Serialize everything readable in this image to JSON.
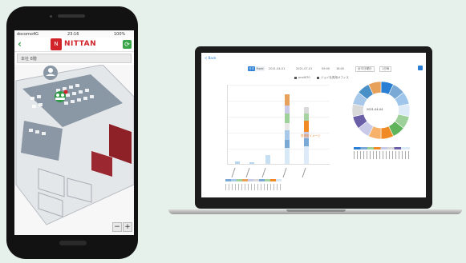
{
  "colors": {
    "brand": "#d0232a",
    "accent": "#2e9a45",
    "primary": "#2a7fd4",
    "highlight": "#f08a24"
  },
  "phone": {
    "status": {
      "carrier": "docomo",
      "network": "4G",
      "time": "23:16",
      "battery": "100%"
    },
    "brand": "NITTAN",
    "floor": "本社 8階",
    "icons": {
      "back": "back-arrow-icon",
      "refresh": "refresh-icon",
      "zoom_out": "minus-icon",
      "zoom_in": "plus-icon",
      "user": "user-icon",
      "group": "group-icon"
    },
    "zoom_out_label": "−",
    "zoom_in_label": "+"
  },
  "laptop": {
    "back": "< Back",
    "toolbar": {
      "toggle_a": "日次",
      "toggle_b": "Fixed",
      "date_from": "2021-04-01",
      "date_to": "2021-07-01",
      "time_from": "09:00",
      "time_to": "18:00",
      "weekday": "全平日曜日",
      "interval": "1日毎"
    },
    "legend": [
      {
        "label": "pro4070"
      },
      {
        "label": "ジョイ社員用オフィス"
      }
    ],
    "overlay": "表現型イメージ",
    "donut_center": "2021-04-04"
  }
}
